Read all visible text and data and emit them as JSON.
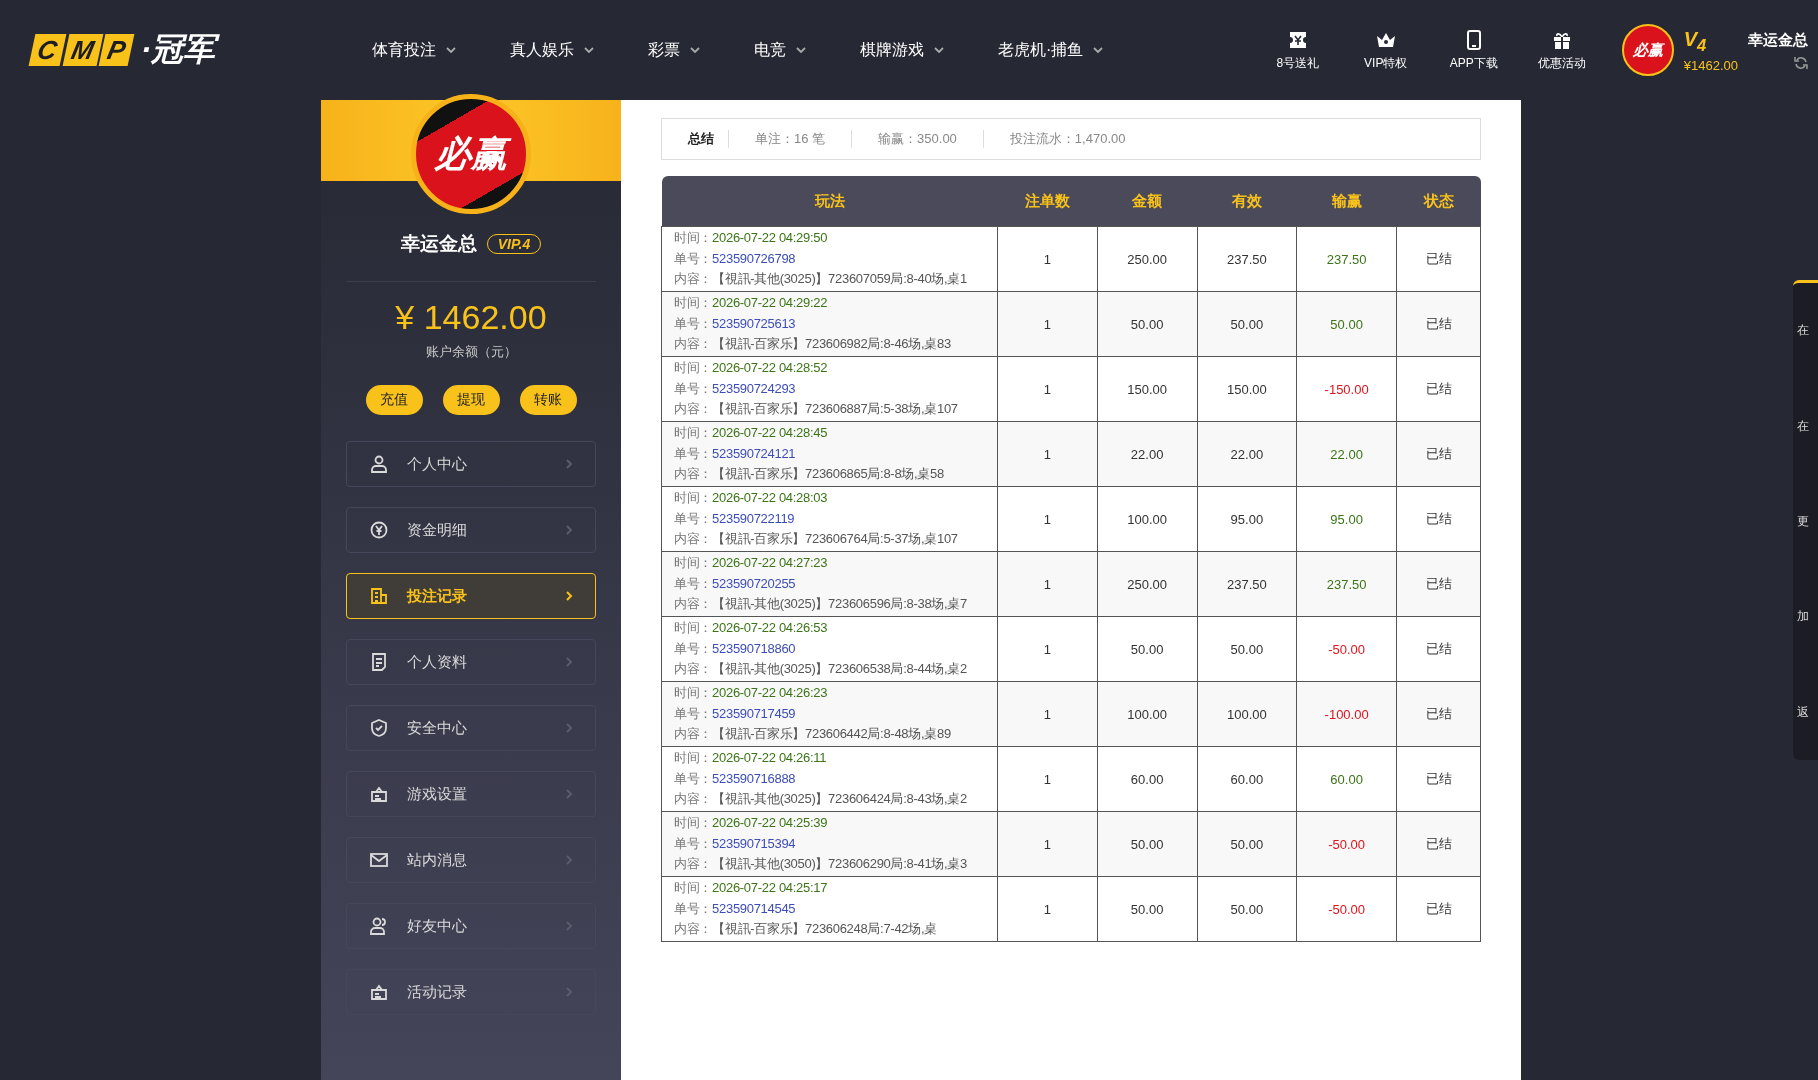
{
  "header": {
    "logo": {
      "letters": [
        "C",
        "M",
        "P"
      ],
      "name": "·冠军"
    },
    "nav": [
      {
        "label": "体育投注",
        "dropdown": true
      },
      {
        "label": "真人娱乐",
        "dropdown": true
      },
      {
        "label": "彩票",
        "dropdown": true
      },
      {
        "label": "电竞",
        "dropdown": true
      },
      {
        "label": "棋牌游戏",
        "dropdown": true
      },
      {
        "label": "老虎机·捕鱼",
        "dropdown": true
      }
    ],
    "quick_links": [
      {
        "label": "8号送礼",
        "kind": "ticket"
      },
      {
        "label": "VIP特权",
        "kind": "crown"
      },
      {
        "label": "APP下载",
        "kind": "phone"
      },
      {
        "label": "优惠活动",
        "kind": "gift"
      }
    ],
    "user": {
      "avatar_text": "必赢",
      "level": "V$_{4}$",
      "name": "幸运金总",
      "balance": "¥1462.00"
    }
  },
  "sidebar": {
    "avatar_text": "必赢",
    "name": "幸运金总",
    "vip": "VIP.4",
    "balance": "¥ 1462.00",
    "balance_label": "账户余额（元）",
    "actions": [
      "充值",
      "提现",
      "转账"
    ],
    "menu": [
      {
        "label": "个人中心",
        "kind": "user",
        "selected": false
      },
      {
        "label": "资金明细",
        "kind": "yuan",
        "selected": false
      },
      {
        "label": "投注记录",
        "kind": "record",
        "selected": true
      },
      {
        "label": "个人资料",
        "kind": "doc",
        "selected": false
      },
      {
        "label": "安全中心",
        "kind": "shield",
        "selected": false
      },
      {
        "label": "游戏设置",
        "kind": "case",
        "selected": false
      },
      {
        "label": "站内消息",
        "kind": "mail",
        "selected": false
      },
      {
        "label": "好友中心",
        "kind": "users",
        "selected": false
      },
      {
        "label": "活动记录",
        "kind": "case",
        "selected": false
      }
    ]
  },
  "summary": {
    "title": "总结",
    "items": [
      "单注：16 笔",
      "输赢：350.00",
      "投注流水：1,470.00"
    ]
  },
  "table": {
    "columns": [
      "玩法",
      "注单数",
      "金额",
      "有效",
      "输赢",
      "状态"
    ],
    "rows": [
      {
        "time_label": "时间：",
        "time": "2026-07-22 04:29:50",
        "order_label": "单号：",
        "order": "523590726798",
        "content_label": "内容：",
        "content": "【視訊-其他(3025)】723607059局:8-40场,桌1",
        "count": "1",
        "amount": "250.00",
        "valid": "237.50",
        "result": "237.50",
        "kind": "win",
        "status": "已结"
      },
      {
        "time_label": "时间：",
        "time": "2026-07-22 04:29:22",
        "order_label": "单号：",
        "order": "523590725613",
        "content_label": "内容：",
        "content": "【視訊-百家乐】723606982局:8-46场,桌83",
        "count": "1",
        "amount": "50.00",
        "valid": "50.00",
        "result": "50.00",
        "kind": "win",
        "status": "已结"
      },
      {
        "time_label": "时间：",
        "time": "2026-07-22 04:28:52",
        "order_label": "单号：",
        "order": "523590724293",
        "content_label": "内容：",
        "content": "【視訊-百家乐】723606887局:5-38场,桌107",
        "count": "1",
        "amount": "150.00",
        "valid": "150.00",
        "result": "-150.00",
        "kind": "loss",
        "status": "已结"
      },
      {
        "time_label": "时间：",
        "time": "2026-07-22 04:28:45",
        "order_label": "单号：",
        "order": "523590724121",
        "content_label": "内容：",
        "content": "【視訊-百家乐】723606865局:8-8场,桌58",
        "count": "1",
        "amount": "22.00",
        "valid": "22.00",
        "result": "22.00",
        "kind": "win",
        "status": "已结"
      },
      {
        "time_label": "时间：",
        "time": "2026-07-22 04:28:03",
        "order_label": "单号：",
        "order": "523590722119",
        "content_label": "内容：",
        "content": "【視訊-百家乐】723606764局:5-37场,桌107",
        "count": "1",
        "amount": "100.00",
        "valid": "95.00",
        "result": "95.00",
        "kind": "win",
        "status": "已结"
      },
      {
        "time_label": "时间：",
        "time": "2026-07-22 04:27:23",
        "order_label": "单号：",
        "order": "523590720255",
        "content_label": "内容：",
        "content": "【視訊-其他(3025)】723606596局:8-38场,桌7",
        "count": "1",
        "amount": "250.00",
        "valid": "237.50",
        "result": "237.50",
        "kind": "win",
        "status": "已结"
      },
      {
        "time_label": "时间：",
        "time": "2026-07-22 04:26:53",
        "order_label": "单号：",
        "order": "523590718860",
        "content_label": "内容：",
        "content": "【視訊-其他(3025)】723606538局:8-44场,桌2",
        "count": "1",
        "amount": "50.00",
        "valid": "50.00",
        "result": "-50.00",
        "kind": "loss",
        "status": "已结"
      },
      {
        "time_label": "时间：",
        "time": "2026-07-22 04:26:23",
        "order_label": "单号：",
        "order": "523590717459",
        "content_label": "内容：",
        "content": "【視訊-百家乐】723606442局:8-48场,桌89",
        "count": "1",
        "amount": "100.00",
        "valid": "100.00",
        "result": "-100.00",
        "kind": "loss",
        "status": "已结"
      },
      {
        "time_label": "时间：",
        "time": "2026-07-22 04:26:11",
        "order_label": "单号：",
        "order": "523590716888",
        "content_label": "内容：",
        "content": "【視訊-其他(3025)】723606424局:8-43场,桌2",
        "count": "1",
        "amount": "60.00",
        "valid": "60.00",
        "result": "60.00",
        "kind": "win",
        "status": "已结"
      },
      {
        "time_label": "时间：",
        "time": "2026-07-22 04:25:39",
        "order_label": "单号：",
        "order": "523590715394",
        "content_label": "内容：",
        "content": "【視訊-其他(3050)】723606290局:8-41场,桌3",
        "count": "1",
        "amount": "50.00",
        "valid": "50.00",
        "result": "-50.00",
        "kind": "loss",
        "status": "已结"
      },
      {
        "time_label": "时间：",
        "time": "2026-07-22 04:25:17",
        "order_label": "单号：",
        "order": "523590714545",
        "content_label": "内容：",
        "content": "【視訊-百家乐】723606248局:7-42场,桌",
        "count": "1",
        "amount": "50.00",
        "valid": "50.00",
        "result": "-50.00",
        "kind": "loss",
        "status": "已结"
      }
    ]
  },
  "side_panel": [
    "在",
    "在",
    "更",
    "加",
    "返"
  ]
}
